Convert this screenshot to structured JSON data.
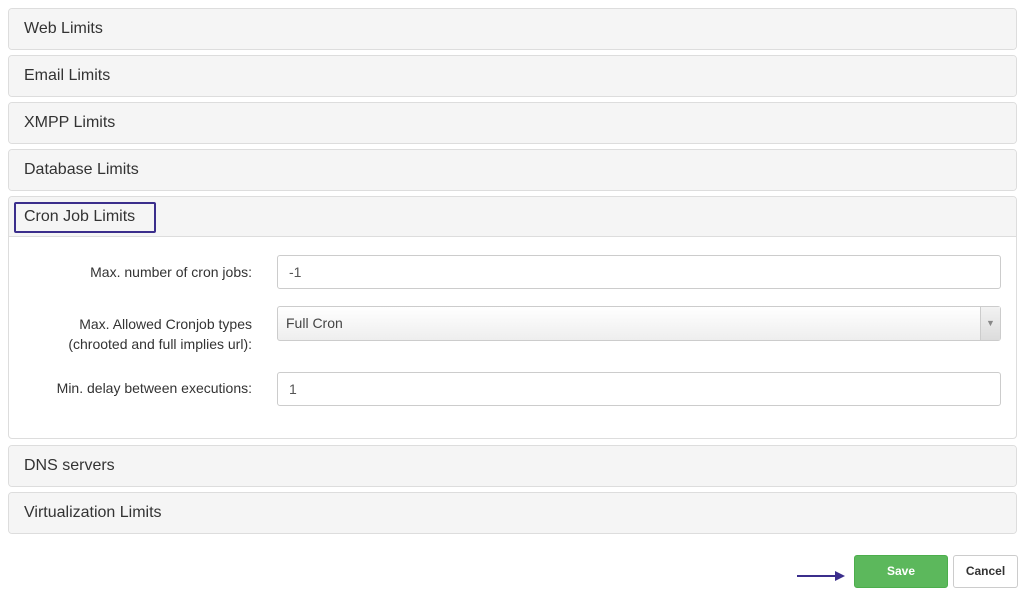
{
  "sections": [
    {
      "title": "Web Limits"
    },
    {
      "title": "Email Limits"
    },
    {
      "title": "XMPP Limits"
    },
    {
      "title": "Database Limits"
    },
    {
      "title": "Cron Job Limits"
    },
    {
      "title": "DNS servers"
    },
    {
      "title": "Virtualization Limits"
    }
  ],
  "cron": {
    "max_jobs_label": "Max. number of cron jobs:",
    "max_jobs_value": "-1",
    "types_label_line1": "Max. Allowed Cronjob types",
    "types_label_line2": "(chrooted and full implies url):",
    "types_value": "Full Cron",
    "min_delay_label": "Min. delay between executions:",
    "min_delay_value": "1"
  },
  "icons": {
    "dropdown": "chevron-down-icon",
    "annotation": "arrow-right-icon"
  },
  "actions": {
    "save": "Save",
    "cancel": "Cancel"
  },
  "colors": {
    "save_button": "#5cb85c",
    "highlight_outline": "#3b2e8c"
  }
}
